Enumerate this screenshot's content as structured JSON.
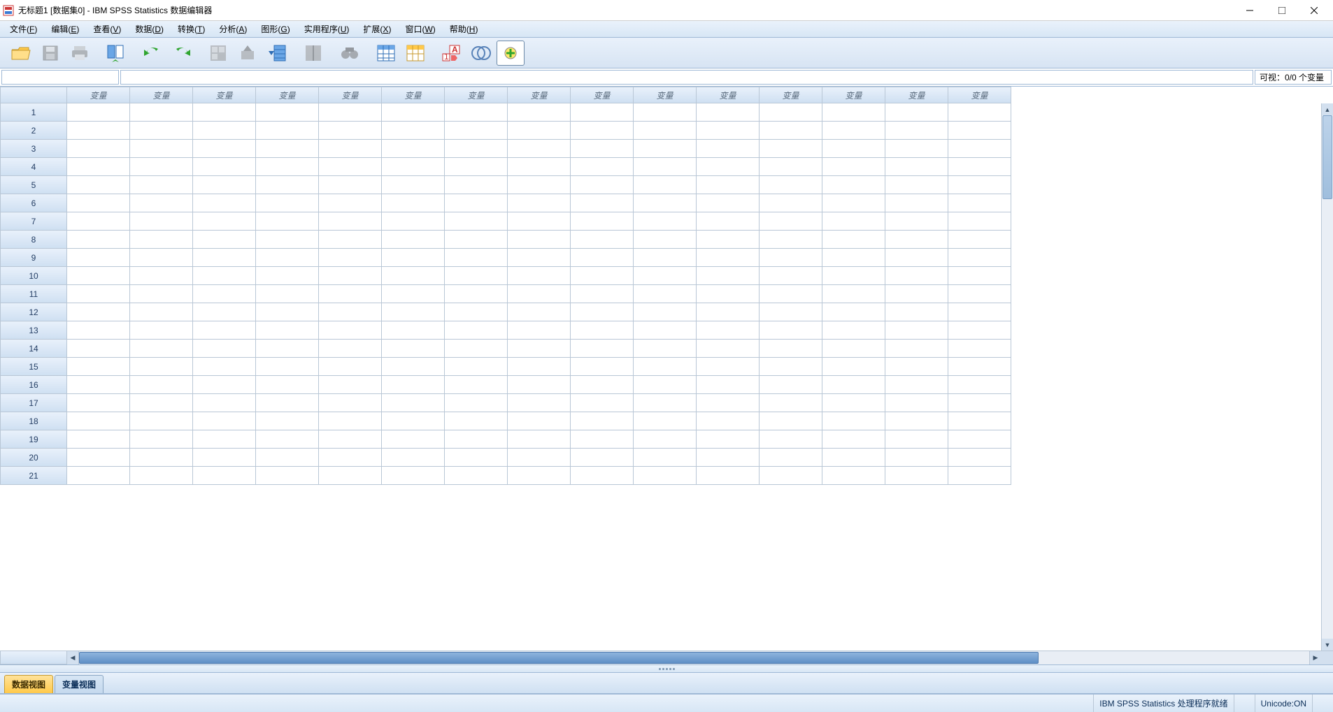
{
  "title": "无标题1 [数据集0] - IBM SPSS Statistics 数据编辑器",
  "menu": {
    "file": {
      "label": "文件(",
      "ul": "F",
      "tail": ")"
    },
    "edit": {
      "label": "编辑(",
      "ul": "E",
      "tail": ")"
    },
    "view": {
      "label": "查看(",
      "ul": "V",
      "tail": ")"
    },
    "data": {
      "label": "数据(",
      "ul": "D",
      "tail": ")"
    },
    "transform": {
      "label": "转换(",
      "ul": "T",
      "tail": ")"
    },
    "analyze": {
      "label": "分析(",
      "ul": "A",
      "tail": ")"
    },
    "graphs": {
      "label": "图形(",
      "ul": "G",
      "tail": ")"
    },
    "util": {
      "label": "实用程序(",
      "ul": "U",
      "tail": ")"
    },
    "ext": {
      "label": "扩展(",
      "ul": "X",
      "tail": ")"
    },
    "window": {
      "label": "窗口(",
      "ul": "W",
      "tail": ")"
    },
    "help": {
      "label": "帮助(",
      "ul": "H",
      "tail": ")"
    }
  },
  "visible_text": "可视：0/0 个变量",
  "column_header_label": "变量",
  "data_view_columns": 15,
  "data_view_rows": 21,
  "tabs": {
    "data": "数据视图",
    "variable": "变量视图"
  },
  "status": {
    "ready": "IBM SPSS Statistics 处理程序就绪",
    "unicode": "Unicode:ON"
  },
  "colors": {
    "accent": "#ffc94a"
  }
}
